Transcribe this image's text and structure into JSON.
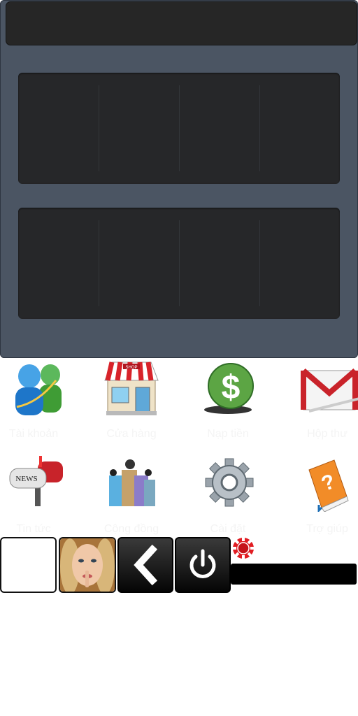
{
  "apps": [
    {
      "id": "messenger",
      "label": "Tài khoản",
      "icon": "messenger-icon"
    },
    {
      "id": "shop",
      "label": "Cửa hàng",
      "icon": "shop-icon"
    },
    {
      "id": "topup",
      "label": "Nạp tiền",
      "icon": "dollar-icon"
    },
    {
      "id": "mail",
      "label": "Hộp thư",
      "icon": "mail-icon"
    },
    {
      "id": "news",
      "label": "Tin tức",
      "icon": "news-mailbox-icon"
    },
    {
      "id": "community",
      "label": "Cộng đồng",
      "icon": "community-icon"
    },
    {
      "id": "settings",
      "label": "Cài đặt",
      "icon": "gear-icon"
    },
    {
      "id": "help",
      "label": "Trợ giúp",
      "icon": "help-book-icon"
    }
  ],
  "bottom_bar": {
    "avatar_icon": "avatar",
    "back_icon": "back-chevron-icon",
    "power_icon": "power-icon",
    "chip_icon": "poker-chip-icon"
  },
  "colors": {
    "panel": "#4b5563",
    "slot": "#262729",
    "chip": "#e11d23"
  }
}
